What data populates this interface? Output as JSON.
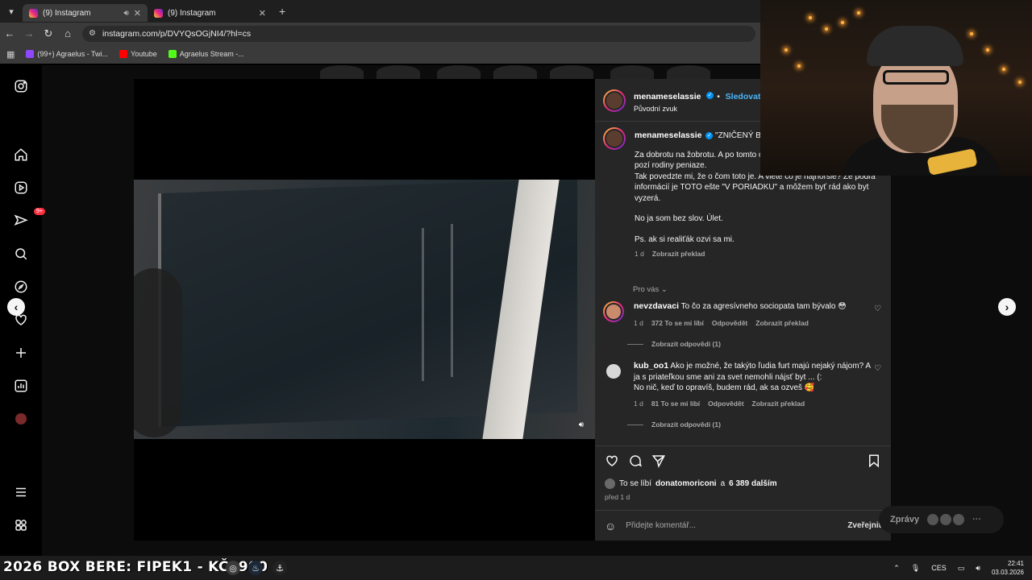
{
  "browser": {
    "tabs": [
      {
        "title": "(9) Instagram",
        "active": true,
        "audio": true
      },
      {
        "title": "(9) Instagram",
        "active": false
      }
    ],
    "url": "instagram.com/p/DVYQsOGjNI4/?hl=cs",
    "bookmarks": [
      {
        "label": "(99+) Agraelus - Twi...",
        "icon": "twitch-icon",
        "color": "#9146ff"
      },
      {
        "label": "Youtube",
        "icon": "youtube-icon",
        "color": "#ff0000"
      },
      {
        "label": "Agraelus Stream -...",
        "icon": "kick-icon",
        "color": "#53fc18"
      }
    ]
  },
  "nav": {
    "notification_badge": "9+"
  },
  "post": {
    "author": "menameselassie",
    "follow_label": "Sledovat",
    "audio": "Původní zvuk",
    "caption_title": "\"ZNIČENÝ BYT\"",
    "caption_paragraphs": [
      "Za dobrotu na žobrotu. A po tomto obviňovať mňa a stavať sa do pozí rodiny peniaze.\nTak povedzte mi, že o čom toto je. A viete čo je najhoršie? Že podľa informácií je TOTO ešte \"V PORIADKU\" a môžem byť rád ako byt vyzerá.",
      "No ja som bez slov. Úlet.",
      "Ps. ak si realiťák ozvi sa mi."
    ],
    "caption_time": "1 d",
    "translate_label": "Zobrazit překlad",
    "for_you_label": "Pro vás",
    "comments": [
      {
        "user": "nevzdavaci",
        "text": "To čo za agresívneho sociopata tam bývalo 😳",
        "time": "1 d",
        "likes": "372 To se mi líbí",
        "reply": "Odpovědět",
        "translate": "Zobrazit překlad",
        "view_replies": "Zobrazit odpovědi (1)"
      },
      {
        "user": "kub_oo1",
        "text": "Ako je možné, že takýto ľudia furt majú nejaký nájom? A ja s priateľkou sme ani za svet nemohli nájsť byt ... (:\nNo nič, keď to opravíš, budem rád, ak sa ozveš 🥰",
        "time": "1 d",
        "likes": "81 To se mi líbí",
        "reply": "Odpovědět",
        "translate": "Zobrazit překlad",
        "view_replies": "Zobrazit odpovědi (1)"
      }
    ],
    "likes_prefix": "To se líbí",
    "likes_user": "donatomoriconi",
    "likes_connector": "a",
    "likes_count": "6 389 dalším",
    "posted_ago": "před 1 d",
    "comment_placeholder": "Přidejte komentář...",
    "post_button": "Zveřejnit"
  },
  "messages_label": "Zprávy",
  "taskbar": {
    "promo": "2026 BOX BERE: FIPEK1 - KČ2900",
    "lang": "CES",
    "time": "22:41",
    "date": "03.03.2026"
  },
  "colors": {
    "accent": "#0095f6",
    "follow": "#4cb5f9",
    "panel": "#262626"
  }
}
